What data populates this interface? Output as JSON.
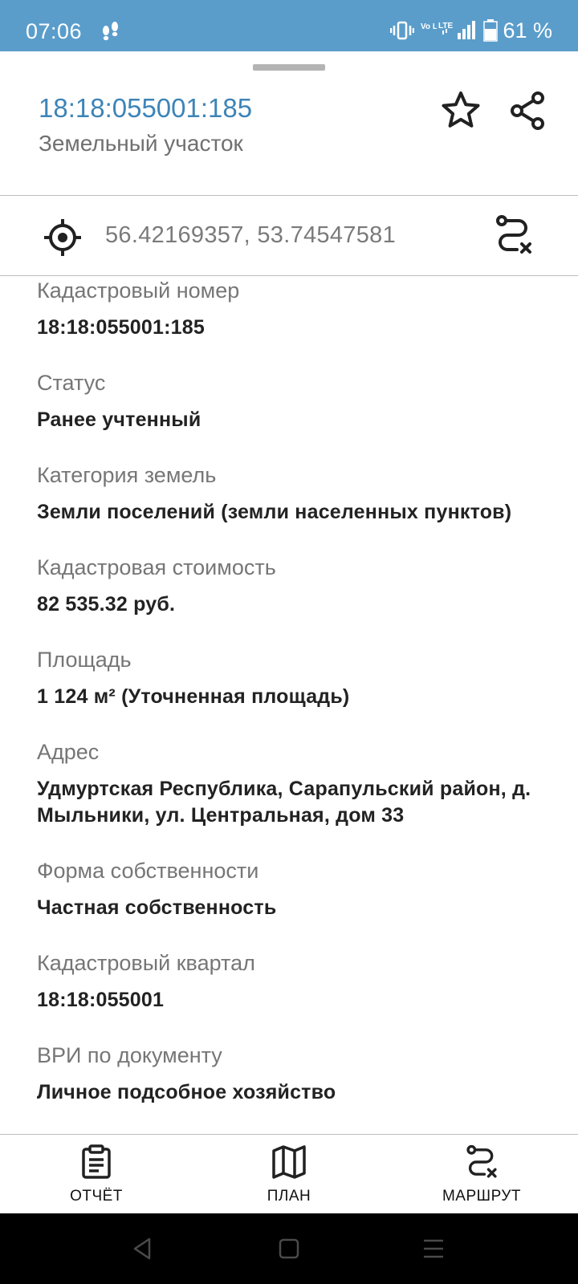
{
  "status_bar": {
    "time": "07:06",
    "network_1": "Vo LTE",
    "network_2": "LTE",
    "battery": "61 %",
    "background_color": "#5a9dcb"
  },
  "header": {
    "title": "18:18:055001:185",
    "subtitle": "Земельный участок",
    "title_color": "#3d84b7",
    "favorite_icon": "star-outline-icon",
    "share_icon": "share-icon"
  },
  "coordinates": {
    "icon": "crosshair-icon",
    "value": "56.42169357, 53.74547581",
    "action_icon": "route-remove-icon"
  },
  "details": [
    {
      "label": "Кадастровый номер",
      "value": "18:18:055001:185"
    },
    {
      "label": "Статус",
      "value": "Ранее учтенный"
    },
    {
      "label": "Категория земель",
      "value": "Земли поселений (земли населенных пунктов)"
    },
    {
      "label": "Кадастровая стоимость",
      "value": "82 535.32 руб."
    },
    {
      "label": "Площадь",
      "value": "1 124 м² (Уточненная площадь)"
    },
    {
      "label": "Адрес",
      "value": "Удмуртская Республика, Сарапульский район, д. Мыльники, ул. Центральная, дом 33"
    },
    {
      "label": "Форма собственности",
      "value": "Частная собственность"
    },
    {
      "label": "Кадастровый квартал",
      "value": "18:18:055001"
    },
    {
      "label": "ВРИ по документу",
      "value": "Личное подсобное хозяйство"
    }
  ],
  "bottom_nav": [
    {
      "label": "ОТЧЁТ",
      "icon": "clipboard-report-icon"
    },
    {
      "label": "ПЛАН",
      "icon": "map-icon"
    },
    {
      "label": "МАРШРУТ",
      "icon": "route-remove-icon"
    }
  ],
  "system_nav": {
    "back_icon": "back-triangle-icon",
    "home_icon": "home-square-icon",
    "recents_icon": "recents-lines-icon"
  }
}
